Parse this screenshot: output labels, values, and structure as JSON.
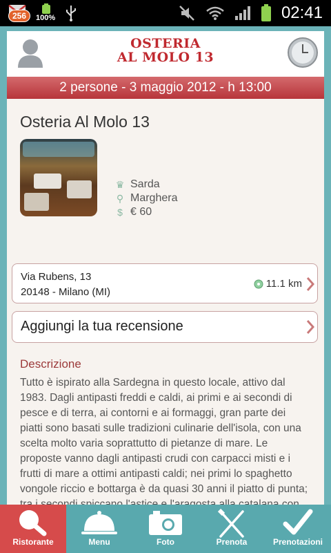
{
  "status_bar": {
    "notification_count": "256",
    "battery_percent": "100%",
    "time": "02:41"
  },
  "header": {
    "logo_line1": "OSTERIA",
    "logo_line2": "AL MOLO 13",
    "banner": "2 persone - 3 maggio 2012 - h 13:00"
  },
  "restaurant": {
    "name": "Osteria Al Molo 13",
    "cuisine": "Sarda",
    "area": "Marghera",
    "price": "€ 60"
  },
  "address": {
    "street": "Via Rubens, 13",
    "city": "20148 - Milano (MI)",
    "distance": "11.1 km"
  },
  "review": {
    "label": "Aggiungi la tua recensione"
  },
  "description": {
    "title": "Descrizione",
    "text": "Tutto è ispirato alla Sardegna in questo locale, attivo dal 1983. Dagli antipasti freddi e caldi, ai primi e ai secondi di pesce e di terra, ai contorni e ai formaggi, gran parte dei piatti sono basati sulle tradizioni culinarie dell'isola, con una scelta molto varia soprattutto di pietanze di mare. Le proposte vanno dagli antipasti crudi con carpacci misti e i frutti di mare a ottimi antipasti caldi; nei primi lo spaghetto vongole riccio e bottarga è da quasi 30 anni il piatto di punta; tra i secondi spiccano l'astice e l'aragosta alla catalana con pesce di lenza"
  },
  "tabs": [
    {
      "label": "Ristorante",
      "icon": "restaurant-icon",
      "active": true
    },
    {
      "label": "Menu",
      "icon": "cloche-icon",
      "active": false
    },
    {
      "label": "Foto",
      "icon": "camera-icon",
      "active": false
    },
    {
      "label": "Prenota",
      "icon": "cutlery-icon",
      "active": false
    },
    {
      "label": "Prenotazioni",
      "icon": "checkmark-icon",
      "active": false
    }
  ],
  "colors": {
    "brand_red": "#c0292f",
    "tab_bar": "#59a9ae",
    "tab_active": "#d64b4b"
  }
}
